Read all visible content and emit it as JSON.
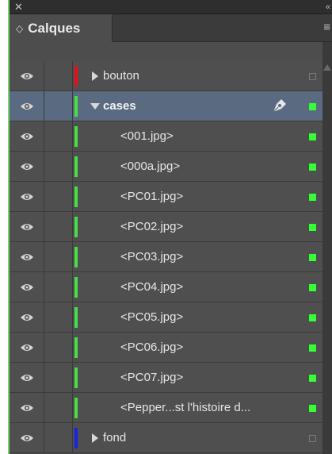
{
  "panel": {
    "close_glyph": "✕",
    "collapse_glyph": "«",
    "menu_glyph": "≡",
    "tab": {
      "chevrons": "◇",
      "title": "Calques"
    }
  },
  "layers": [
    {
      "name": "bouton",
      "kind": "layer",
      "expanded": false,
      "color": "#e8101a",
      "box": "empty"
    },
    {
      "name": "cases",
      "kind": "layer",
      "expanded": true,
      "color": "#46e046",
      "box": "green",
      "selected": true,
      "icon": "pen-icon"
    },
    {
      "name": "<001.jpg>",
      "kind": "item",
      "color": "#46e046",
      "box": "green"
    },
    {
      "name": "<000a.jpg>",
      "kind": "item",
      "color": "#46e046",
      "box": "green"
    },
    {
      "name": "<PC01.jpg>",
      "kind": "item",
      "color": "#46e046",
      "box": "green"
    },
    {
      "name": "<PC02.jpg>",
      "kind": "item",
      "color": "#46e046",
      "box": "green"
    },
    {
      "name": "<PC03.jpg>",
      "kind": "item",
      "color": "#46e046",
      "box": "green"
    },
    {
      "name": "<PC04.jpg>",
      "kind": "item",
      "color": "#46e046",
      "box": "green"
    },
    {
      "name": "<PC05.jpg>",
      "kind": "item",
      "color": "#46e046",
      "box": "green"
    },
    {
      "name": "<PC06.jpg>",
      "kind": "item",
      "color": "#46e046",
      "box": "green"
    },
    {
      "name": "<PC07.jpg>",
      "kind": "item",
      "color": "#46e046",
      "box": "green"
    },
    {
      "name": "<Pepper...st l'histoire d...",
      "kind": "item",
      "color": "#46e046",
      "box": "green"
    },
    {
      "name": "fond",
      "kind": "layer",
      "expanded": false,
      "color": "#1a22e8",
      "box": "empty"
    }
  ]
}
